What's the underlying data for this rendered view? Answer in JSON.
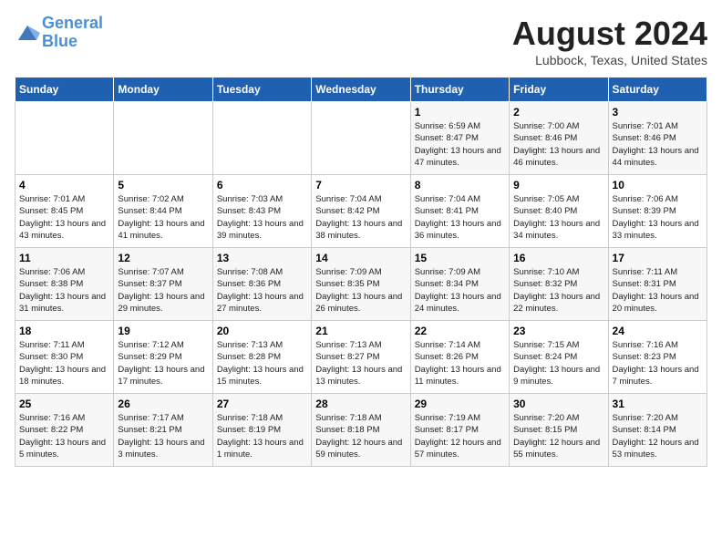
{
  "header": {
    "logo_line1": "General",
    "logo_line2": "Blue",
    "month": "August 2024",
    "location": "Lubbock, Texas, United States"
  },
  "weekdays": [
    "Sunday",
    "Monday",
    "Tuesday",
    "Wednesday",
    "Thursday",
    "Friday",
    "Saturday"
  ],
  "weeks": [
    [
      {
        "day": "",
        "info": ""
      },
      {
        "day": "",
        "info": ""
      },
      {
        "day": "",
        "info": ""
      },
      {
        "day": "",
        "info": ""
      },
      {
        "day": "1",
        "info": "Sunrise: 6:59 AM\nSunset: 8:47 PM\nDaylight: 13 hours and 47 minutes."
      },
      {
        "day": "2",
        "info": "Sunrise: 7:00 AM\nSunset: 8:46 PM\nDaylight: 13 hours and 46 minutes."
      },
      {
        "day": "3",
        "info": "Sunrise: 7:01 AM\nSunset: 8:46 PM\nDaylight: 13 hours and 44 minutes."
      }
    ],
    [
      {
        "day": "4",
        "info": "Sunrise: 7:01 AM\nSunset: 8:45 PM\nDaylight: 13 hours and 43 minutes."
      },
      {
        "day": "5",
        "info": "Sunrise: 7:02 AM\nSunset: 8:44 PM\nDaylight: 13 hours and 41 minutes."
      },
      {
        "day": "6",
        "info": "Sunrise: 7:03 AM\nSunset: 8:43 PM\nDaylight: 13 hours and 39 minutes."
      },
      {
        "day": "7",
        "info": "Sunrise: 7:04 AM\nSunset: 8:42 PM\nDaylight: 13 hours and 38 minutes."
      },
      {
        "day": "8",
        "info": "Sunrise: 7:04 AM\nSunset: 8:41 PM\nDaylight: 13 hours and 36 minutes."
      },
      {
        "day": "9",
        "info": "Sunrise: 7:05 AM\nSunset: 8:40 PM\nDaylight: 13 hours and 34 minutes."
      },
      {
        "day": "10",
        "info": "Sunrise: 7:06 AM\nSunset: 8:39 PM\nDaylight: 13 hours and 33 minutes."
      }
    ],
    [
      {
        "day": "11",
        "info": "Sunrise: 7:06 AM\nSunset: 8:38 PM\nDaylight: 13 hours and 31 minutes."
      },
      {
        "day": "12",
        "info": "Sunrise: 7:07 AM\nSunset: 8:37 PM\nDaylight: 13 hours and 29 minutes."
      },
      {
        "day": "13",
        "info": "Sunrise: 7:08 AM\nSunset: 8:36 PM\nDaylight: 13 hours and 27 minutes."
      },
      {
        "day": "14",
        "info": "Sunrise: 7:09 AM\nSunset: 8:35 PM\nDaylight: 13 hours and 26 minutes."
      },
      {
        "day": "15",
        "info": "Sunrise: 7:09 AM\nSunset: 8:34 PM\nDaylight: 13 hours and 24 minutes."
      },
      {
        "day": "16",
        "info": "Sunrise: 7:10 AM\nSunset: 8:32 PM\nDaylight: 13 hours and 22 minutes."
      },
      {
        "day": "17",
        "info": "Sunrise: 7:11 AM\nSunset: 8:31 PM\nDaylight: 13 hours and 20 minutes."
      }
    ],
    [
      {
        "day": "18",
        "info": "Sunrise: 7:11 AM\nSunset: 8:30 PM\nDaylight: 13 hours and 18 minutes."
      },
      {
        "day": "19",
        "info": "Sunrise: 7:12 AM\nSunset: 8:29 PM\nDaylight: 13 hours and 17 minutes."
      },
      {
        "day": "20",
        "info": "Sunrise: 7:13 AM\nSunset: 8:28 PM\nDaylight: 13 hours and 15 minutes."
      },
      {
        "day": "21",
        "info": "Sunrise: 7:13 AM\nSunset: 8:27 PM\nDaylight: 13 hours and 13 minutes."
      },
      {
        "day": "22",
        "info": "Sunrise: 7:14 AM\nSunset: 8:26 PM\nDaylight: 13 hours and 11 minutes."
      },
      {
        "day": "23",
        "info": "Sunrise: 7:15 AM\nSunset: 8:24 PM\nDaylight: 13 hours and 9 minutes."
      },
      {
        "day": "24",
        "info": "Sunrise: 7:16 AM\nSunset: 8:23 PM\nDaylight: 13 hours and 7 minutes."
      }
    ],
    [
      {
        "day": "25",
        "info": "Sunrise: 7:16 AM\nSunset: 8:22 PM\nDaylight: 13 hours and 5 minutes."
      },
      {
        "day": "26",
        "info": "Sunrise: 7:17 AM\nSunset: 8:21 PM\nDaylight: 13 hours and 3 minutes."
      },
      {
        "day": "27",
        "info": "Sunrise: 7:18 AM\nSunset: 8:19 PM\nDaylight: 13 hours and 1 minute."
      },
      {
        "day": "28",
        "info": "Sunrise: 7:18 AM\nSunset: 8:18 PM\nDaylight: 12 hours and 59 minutes."
      },
      {
        "day": "29",
        "info": "Sunrise: 7:19 AM\nSunset: 8:17 PM\nDaylight: 12 hours and 57 minutes."
      },
      {
        "day": "30",
        "info": "Sunrise: 7:20 AM\nSunset: 8:15 PM\nDaylight: 12 hours and 55 minutes."
      },
      {
        "day": "31",
        "info": "Sunrise: 7:20 AM\nSunset: 8:14 PM\nDaylight: 12 hours and 53 minutes."
      }
    ]
  ]
}
